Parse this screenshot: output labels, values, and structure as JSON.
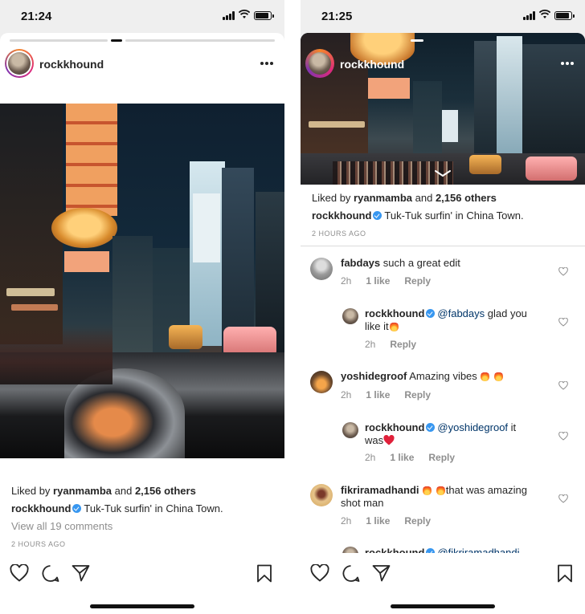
{
  "left": {
    "status": {
      "time": "21:24"
    },
    "post": {
      "username": "rockkhound",
      "liked_by_prefix": "Liked by ",
      "liked_by_user": "ryanmamba",
      "liked_by_and": " and ",
      "liked_by_count": "2,156 others",
      "caption_user": "rockkhound",
      "caption_text": "Tuk-Tuk surfin' in China Town.",
      "view_comments": "View all 19 comments",
      "timestamp": "2 HOURS AGO"
    }
  },
  "right": {
    "status": {
      "time": "21:25"
    },
    "post": {
      "username": "rockkhound",
      "liked_by_prefix": "Liked by ",
      "liked_by_user": "ryanmamba",
      "liked_by_and": " and ",
      "liked_by_count": "2,156 others",
      "caption_user": "rockkhound",
      "caption_text": "Tuk-Tuk surfin' in China Town.",
      "timestamp": "2 HOURS AGO"
    },
    "comments": [
      {
        "user": "fabdays",
        "text": "such a great edit",
        "time": "2h",
        "likes": "1 like",
        "reply": "Reply"
      },
      {
        "user": "rockkhound",
        "mention": "@fabdays",
        "text_a": " glad you",
        "text_b": "like it",
        "time": "2h",
        "reply": "Reply"
      },
      {
        "user": "yoshidegroof",
        "text": "Amazing vibes",
        "time": "2h",
        "likes": "1 like",
        "reply": "Reply"
      },
      {
        "user": "rockkhound",
        "mention": "@yoshidegroof",
        "text_a": " it",
        "text_b": "was",
        "time": "2h",
        "likes": "1 like",
        "reply": "Reply"
      },
      {
        "user": "fikriramadhandi",
        "text_a": "that was amazing",
        "text_b": "shot man",
        "time": "2h",
        "likes": "1 like",
        "reply": "Reply"
      },
      {
        "user": "rockkhound",
        "mention": "@fikriramadhandi"
      }
    ]
  },
  "colors": {
    "verified": "#3897f0",
    "mention": "#003569",
    "muted": "#8e8e8e",
    "text": "#262626"
  },
  "icons": [
    "signal-icon",
    "wifi-icon",
    "battery-icon",
    "more-options-icon",
    "heart-icon",
    "comment-icon",
    "share-icon",
    "bookmark-icon",
    "verified-icon",
    "fire-emoji",
    "heart-emoji"
  ]
}
